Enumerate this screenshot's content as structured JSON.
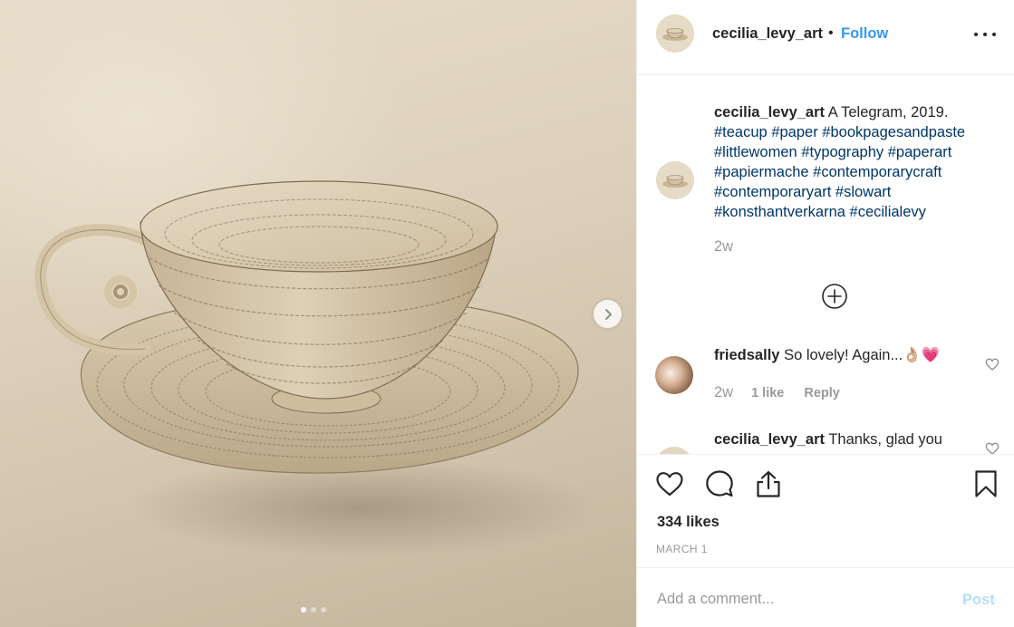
{
  "post": {
    "image_alt": "Teacup and saucer made from book pages",
    "carousel_count": 3,
    "carousel_active": 1
  },
  "header": {
    "username": "cecilia_levy_art",
    "separator": "•",
    "follow_label": "Follow"
  },
  "caption": {
    "username": "cecilia_levy_art",
    "text": "A Telegram, 2019.",
    "hashtags": [
      "#teacup",
      "#paper",
      "#bookpagesandpaste",
      "#littlewomen",
      "#typography",
      "#paperart",
      "#papiermache",
      "#contemporarycraft",
      "#contemporaryart",
      "#slowart",
      "#konsthantverkarna",
      "#cecilialevy"
    ],
    "time": "2w"
  },
  "comments": [
    {
      "username": "friedsally",
      "text": "So lovely! Again...👌🏼💗",
      "time": "2w",
      "likes": "1 like",
      "reply_label": "Reply"
    },
    {
      "username": "cecilia_levy_art",
      "text": "Thanks, glad you"
    }
  ],
  "actions": {
    "likes": "334 likes",
    "date": "MARCH 1"
  },
  "comment_box": {
    "placeholder": "Add a comment...",
    "post_label": "Post"
  },
  "icons": {
    "like": "heart-icon",
    "comment": "comment-bubble-icon",
    "share": "share-icon",
    "save": "bookmark-icon",
    "more": "more-options-icon",
    "next": "chevron-right-icon",
    "load_more": "plus-circle-icon"
  },
  "colors": {
    "link_blue": "#3897f0",
    "hashtag": "#003569",
    "muted": "#999999",
    "post_disabled": "#b2dffc"
  }
}
